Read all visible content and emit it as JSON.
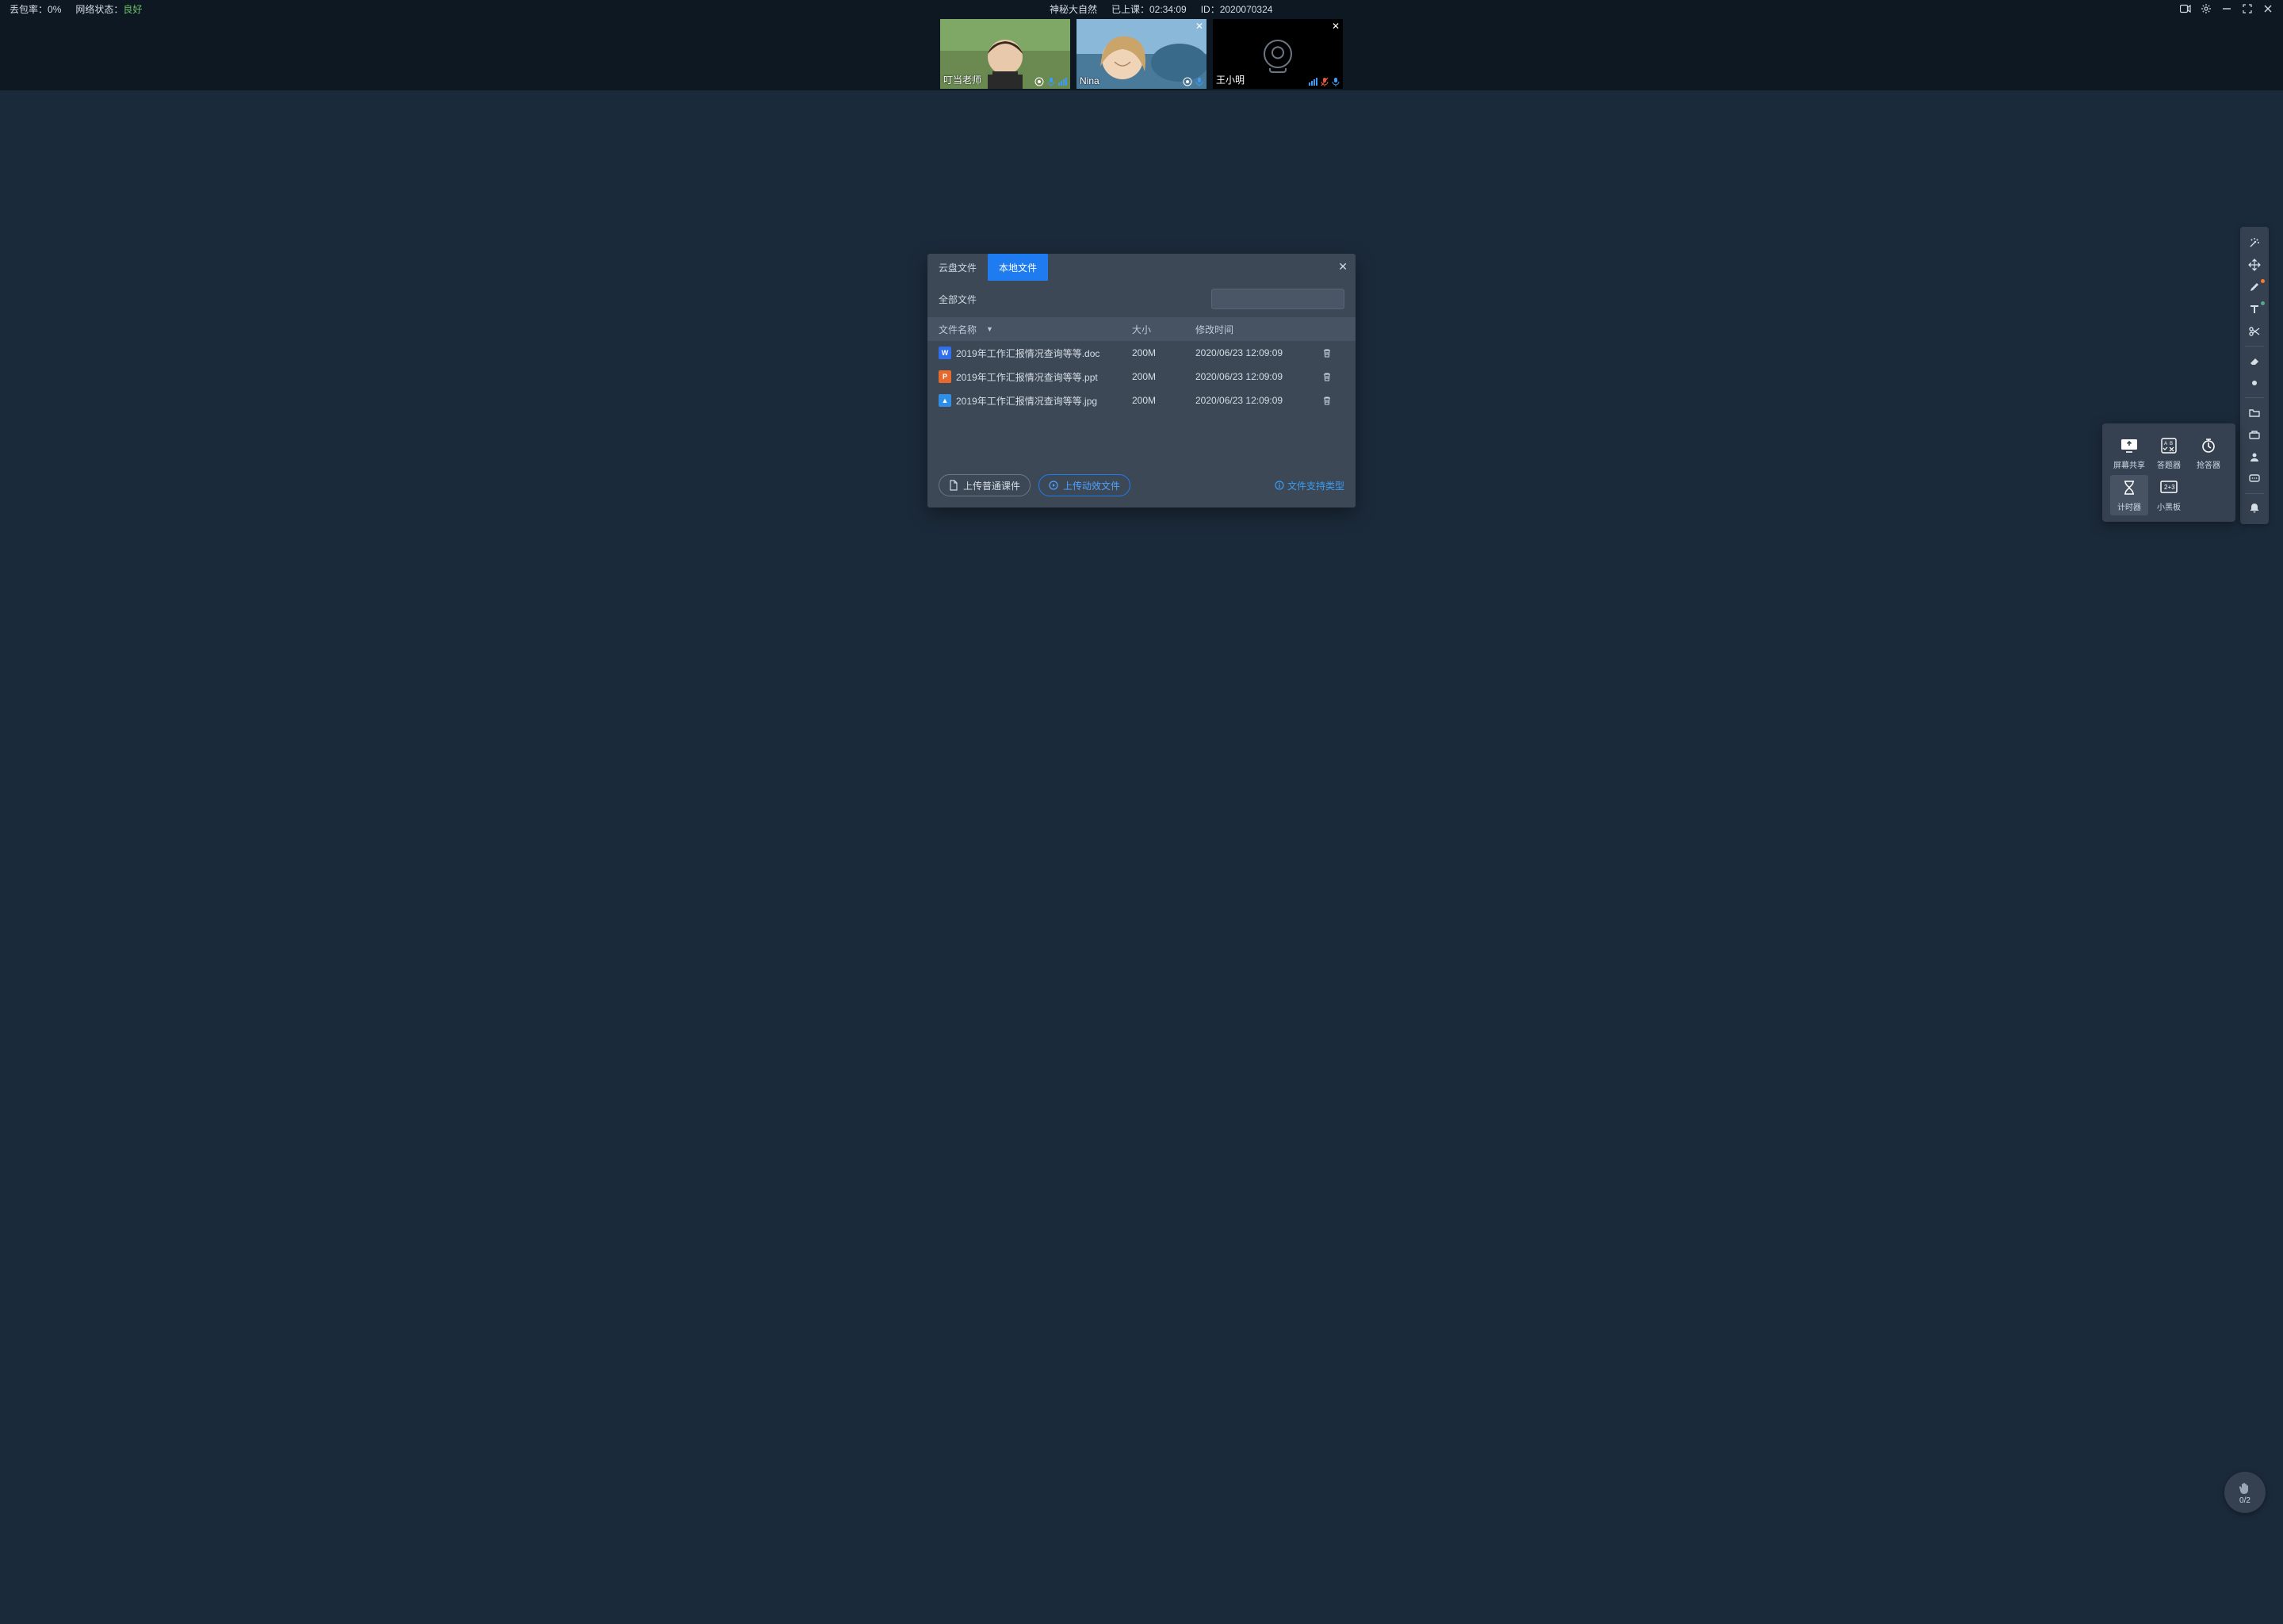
{
  "topbar": {
    "packet_loss_label": "丢包率：",
    "packet_loss_value": "0%",
    "network_label": "网络状态：",
    "network_value": "良好",
    "title": "神秘大自然",
    "class_time_label": "已上课：",
    "class_time_value": "02:34:09",
    "id_label": "ID：",
    "id_value": "2020070324"
  },
  "participants": [
    {
      "name": "叮当老师",
      "cam_off": false,
      "closable": false,
      "mic_muted": false
    },
    {
      "name": "Nina",
      "cam_off": false,
      "closable": true,
      "mic_muted": false
    },
    {
      "name": "王小明",
      "cam_off": true,
      "closable": true,
      "mic_muted": true
    }
  ],
  "modal": {
    "tabs": {
      "cloud": "云盘文件",
      "local": "本地文件"
    },
    "filter_label": "全部文件",
    "columns": {
      "name": "文件名称",
      "size": "大小",
      "time": "修改时间"
    },
    "files": [
      {
        "icon": "doc",
        "icon_letter": "W",
        "name": "2019年工作汇报情况查询等等.doc",
        "size": "200M",
        "time": "2020/06/23 12:09:09"
      },
      {
        "icon": "ppt",
        "icon_letter": "P",
        "name": "2019年工作汇报情况查询等等.ppt",
        "size": "200M",
        "time": "2020/06/23 12:09:09"
      },
      {
        "icon": "img",
        "icon_letter": "▲",
        "name": "2019年工作汇报情况查询等等.jpg",
        "size": "200M",
        "time": "2020/06/23 12:09:09"
      }
    ],
    "upload_normal": "上传普通课件",
    "upload_animated": "上传动效文件",
    "support_link": "文件支持类型"
  },
  "tool_panel": {
    "items": [
      {
        "key": "screen_share",
        "label": "屏幕共享"
      },
      {
        "key": "answer",
        "label": "答题器"
      },
      {
        "key": "rush",
        "label": "抢答器"
      },
      {
        "key": "timer",
        "label": "计时器",
        "selected": true
      },
      {
        "key": "blackboard",
        "label": "小黑板"
      }
    ]
  },
  "hand": {
    "count": "0/2"
  }
}
